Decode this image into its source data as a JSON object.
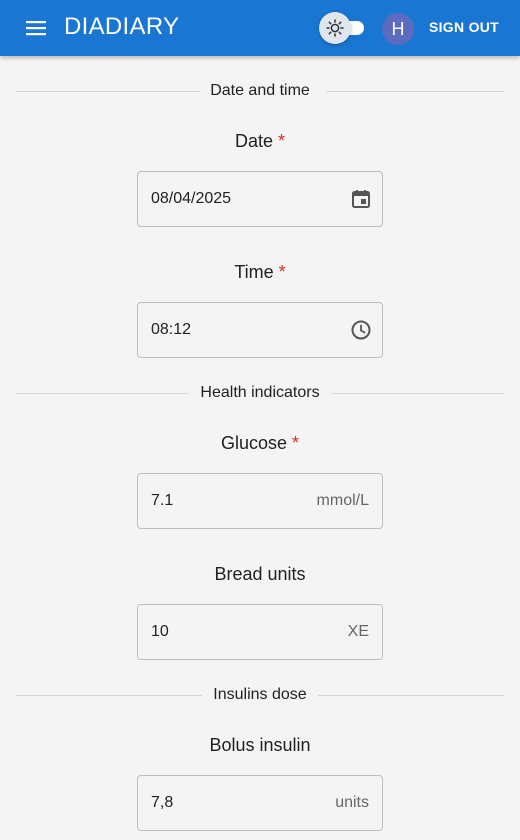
{
  "header": {
    "title": "DIADIARY",
    "avatar_initial": "H",
    "sign_out_label": "SIGN OUT",
    "background_color": "#1976d2"
  },
  "sections": {
    "date_time": "Date and time",
    "health": "Health indicators",
    "insulins": "Insulins dose"
  },
  "fields": {
    "date": {
      "label": "Date",
      "required_mark": "*",
      "value": "08/04/2025",
      "icon": "calendar-icon"
    },
    "time": {
      "label": "Time",
      "required_mark": "*",
      "value": "08:12",
      "icon": "clock-icon"
    },
    "glucose": {
      "label": "Glucose",
      "required_mark": "*",
      "value": "7.1",
      "unit": "mmol/L"
    },
    "bread_units": {
      "label": "Bread units",
      "value": "10",
      "unit": "XE"
    },
    "bolus_insulin": {
      "label": "Bolus insulin",
      "value": "7,8",
      "unit": "units"
    }
  },
  "icons": {
    "menu": "menu-icon",
    "theme": "sun-icon"
  },
  "colors": {
    "required": "#d32f2f",
    "avatar": "#5c6bc0"
  }
}
